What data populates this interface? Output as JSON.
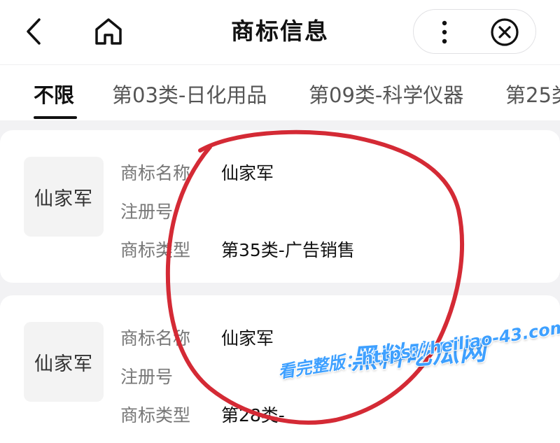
{
  "header": {
    "title": "商标信息",
    "back_icon": "chevron-left-icon",
    "home_icon": "home-icon",
    "more_icon": "more-vertical-icon",
    "close_icon": "close-circle-icon"
  },
  "tabs": [
    {
      "label": "不限",
      "active": true
    },
    {
      "label": "第03类-日化用品",
      "active": false
    },
    {
      "label": "第09类-科学仪器",
      "active": false
    },
    {
      "label": "第25类",
      "active": false
    }
  ],
  "trademarks": [
    {
      "logo_text": "仙家军",
      "name_label": "商标名称",
      "name_value": "仙家军",
      "reg_label": "注册号",
      "reg_value": "",
      "type_label": "商标类型",
      "type_value": "第35类-广告销售"
    },
    {
      "logo_text": "仙家军",
      "name_label": "商标名称",
      "name_value": "仙家军",
      "reg_label": "注册号",
      "reg_value": "",
      "type_label": "商标类型",
      "type_value": "第28类-"
    }
  ],
  "watermark": {
    "brand": "黑料吃瓜网",
    "url_text": "看完整版：https://heiliao-43.com",
    "color": "#3ea0ff"
  },
  "annotation": {
    "circle_color": "#d42a35"
  }
}
